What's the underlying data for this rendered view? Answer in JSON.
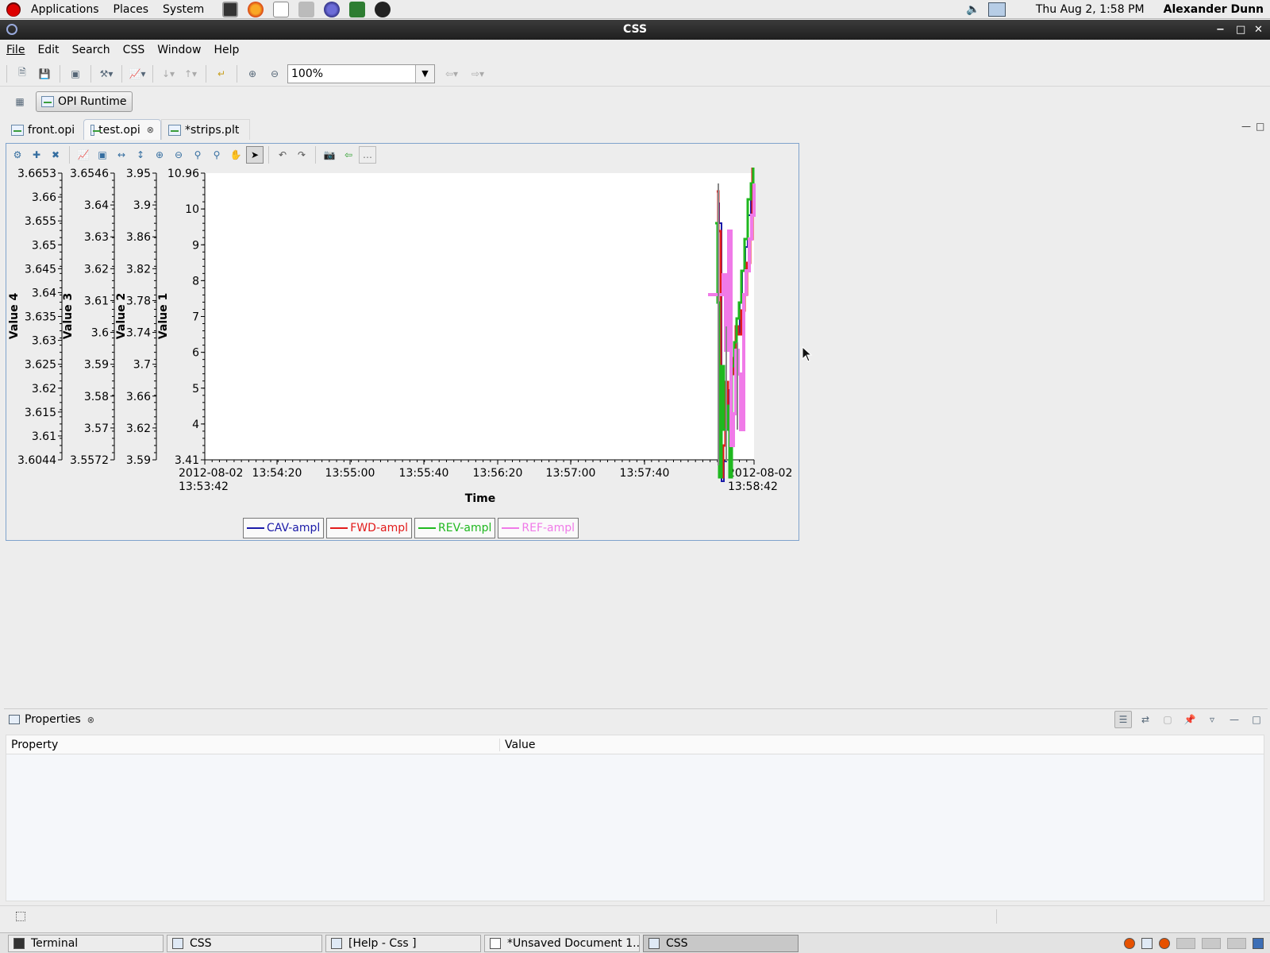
{
  "panel": {
    "menus": [
      "Applications",
      "Places",
      "System"
    ],
    "date": "Thu Aug  2,  1:58 PM",
    "user": "Alexander Dunn"
  },
  "window": {
    "title": "CSS"
  },
  "menubar": [
    "File",
    "Edit",
    "Search",
    "CSS",
    "Window",
    "Help"
  ],
  "toolbar": {
    "zoom": "100%"
  },
  "perspective": {
    "label": "OPI Runtime"
  },
  "tabs": [
    {
      "label": "front.opi"
    },
    {
      "label": "test.opi"
    },
    {
      "label": "*strips.plt"
    }
  ],
  "chart_data": {
    "type": "line",
    "xlabel": "Time",
    "x_start": "2012-08-02 13:53:42",
    "x_end": "2012-08-02 13:58:42",
    "x_ticks": [
      "2012-08-02\n13:53:42",
      "13:54:20",
      "13:55:00",
      "13:55:40",
      "13:56:20",
      "13:57:00",
      "13:57:40",
      "2012-08-02\n13:58:42"
    ],
    "y_axes": [
      {
        "label": "Value 4",
        "ticks": [
          "3.6653",
          "3.66",
          "3.655",
          "3.65",
          "3.645",
          "3.64",
          "3.635",
          "3.63",
          "3.625",
          "3.62",
          "3.615",
          "3.61",
          "3.6044"
        ]
      },
      {
        "label": "Value 3",
        "ticks": [
          "3.6546",
          "3.64",
          "3.63",
          "3.62",
          "3.61",
          "3.6",
          "3.59",
          "3.58",
          "3.57",
          "3.5572"
        ]
      },
      {
        "label": "Value 2",
        "ticks": [
          "3.95",
          "3.9",
          "3.86",
          "3.82",
          "3.78",
          "3.74",
          "3.7",
          "3.66",
          "3.62",
          "3.59"
        ]
      },
      {
        "label": "Value 1",
        "ticks": [
          "10.96",
          "10",
          "9",
          "8",
          "7",
          "6",
          "5",
          "4",
          "3.41"
        ],
        "ylim": [
          3.41,
          10.96
        ]
      }
    ],
    "series": [
      {
        "name": "CAV-ampl",
        "color": "#1a1aa8"
      },
      {
        "name": "FWD-ampl",
        "color": "#e21b1b"
      },
      {
        "name": "REV-ampl",
        "color": "#1fb81f"
      },
      {
        "name": "REF-ampl",
        "color": "#f07ae8"
      }
    ]
  },
  "properties": {
    "title": "Properties",
    "col_property": "Property",
    "col_value": "Value"
  },
  "taskbar": [
    {
      "label": "Terminal"
    },
    {
      "label": "CSS"
    },
    {
      "label": "[Help - Css ]"
    },
    {
      "label": "*Unsaved Document 1..."
    },
    {
      "label": "CSS"
    }
  ]
}
